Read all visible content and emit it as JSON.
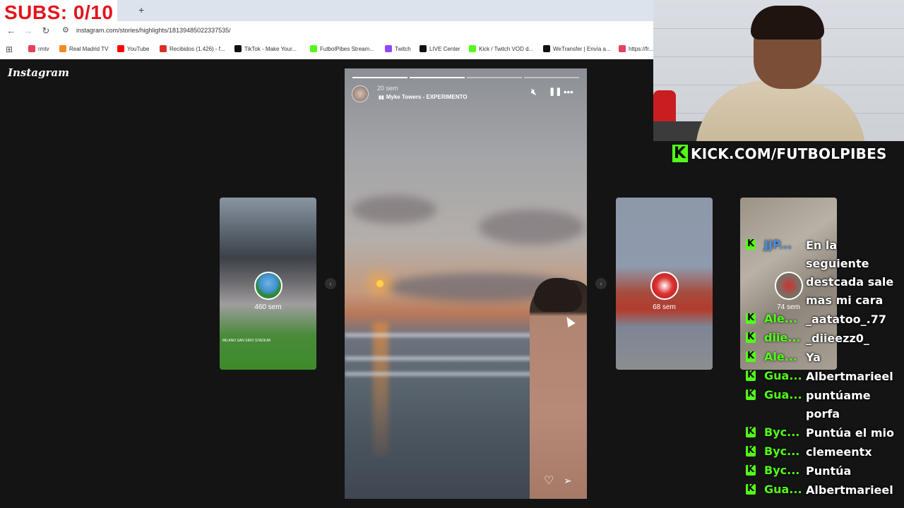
{
  "overlay": {
    "subs_counter": "SUBS: 0/10"
  },
  "browser": {
    "new_tab_icon": "plus-icon",
    "url": "instagram.com/stories/highlights/18139485022337535/",
    "bookmarks": [
      {
        "label": "rmtv",
        "color": "#e4405f"
      },
      {
        "label": "Real Madrid TV",
        "color": "#f28b24"
      },
      {
        "label": "YouTube",
        "color": "#ff0000"
      },
      {
        "label": "Recibidos (1.426) - f...",
        "color": "#d93025"
      },
      {
        "label": "TikTok - Make Your...",
        "color": "#111111"
      },
      {
        "label": "FutbolPibes Stream...",
        "color": "#53fc18"
      },
      {
        "label": "Twitch",
        "color": "#9146ff"
      },
      {
        "label": "LIVE Center",
        "color": "#111111"
      },
      {
        "label": "Kick / Twitch VOD d...",
        "color": "#53fc18"
      },
      {
        "label": "WeTransfer | Envía a...",
        "color": "#111111"
      },
      {
        "label": "https://fr...",
        "color": "#e4405f"
      }
    ]
  },
  "instagram": {
    "logo": "Instagram",
    "side_stories": [
      {
        "age": "460 sem",
        "caption": "MILANO SAN SIRO STADIUM"
      },
      {
        "age": "68 sem"
      },
      {
        "age": "74 sem"
      }
    ],
    "story": {
      "age": "20 sem",
      "music": "Myke Towers - EXPERIMENTO",
      "progress_segments": 4,
      "progress_done": 2
    }
  },
  "stream": {
    "kick_url": "KICK.COM/FUTBOLPIBES",
    "brand_color": "#53fc18"
  },
  "chat": [
    {
      "user": "JJP...",
      "text": "En la seguiente destcada sale mas mi cara",
      "user_color": "#4a90e2"
    },
    {
      "user": "Ale...",
      "text": "_aatatoo_.77",
      "user_color": "#53fc18"
    },
    {
      "user": "diie...",
      "text": "_diieezz0_",
      "user_color": "#53fc18"
    },
    {
      "user": "Ale...",
      "text": "Ya",
      "user_color": "#53fc18"
    },
    {
      "user": "Gua...",
      "text": "Albertmarieel",
      "user_color": "#53fc18"
    },
    {
      "user": "Gua...",
      "text": "puntúame porfa",
      "user_color": "#53fc18"
    },
    {
      "user": "Byc...",
      "text": "Puntúa el mio",
      "user_color": "#53fc18"
    },
    {
      "user": "Byc...",
      "text": "clemeentx",
      "user_color": "#53fc18"
    },
    {
      "user": "Byc...",
      "text": "Puntúa",
      "user_color": "#53fc18"
    },
    {
      "user": "Gua...",
      "text": "Albertmarieel",
      "user_color": "#53fc18"
    }
  ]
}
